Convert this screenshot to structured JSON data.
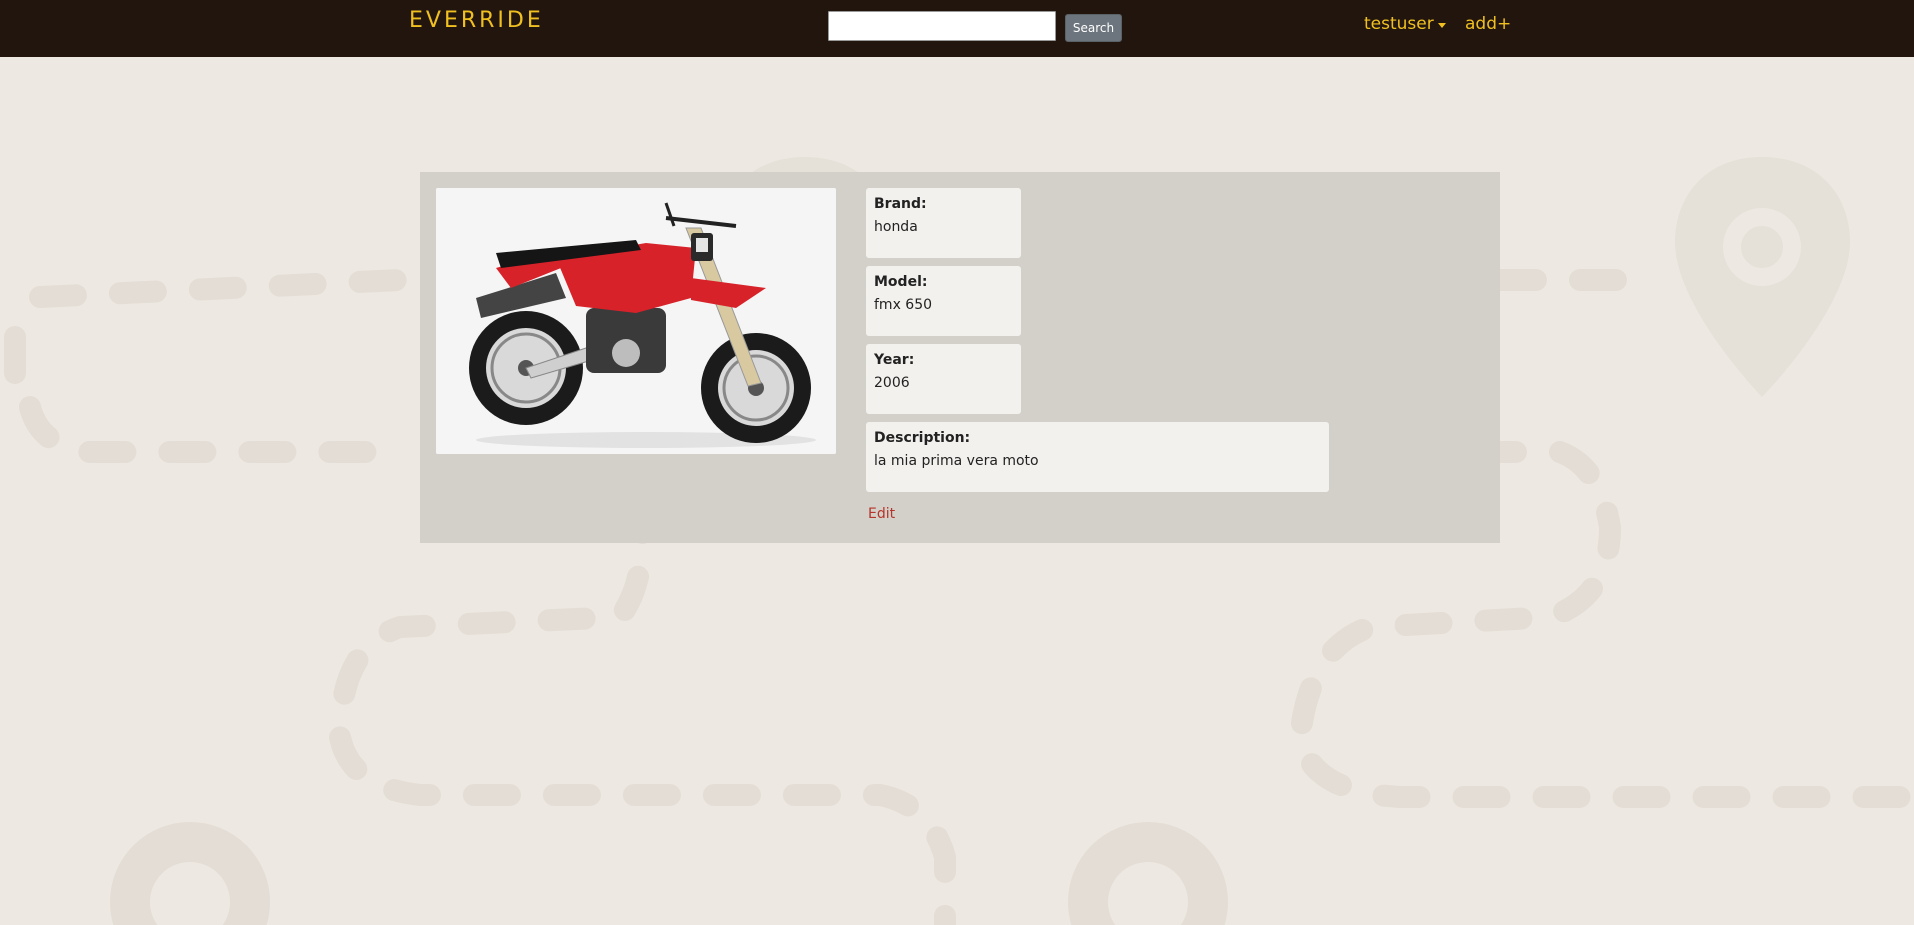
{
  "navbar": {
    "brand": "EVERRIDE",
    "search": {
      "value": "",
      "placeholder": "",
      "button_label": "Search"
    },
    "user_menu": "testuser",
    "add_link": "add+"
  },
  "motorcycle": {
    "photo_alt": "honda fmx 650",
    "fields": [
      {
        "label": "Brand:",
        "value": "honda"
      },
      {
        "label": "Model:",
        "value": "fmx 650"
      },
      {
        "label": "Year:",
        "value": "2006"
      },
      {
        "label": "Description:",
        "value": "la mia prima vera moto"
      }
    ],
    "edit_label": "Edit"
  },
  "colors": {
    "navbar_bg": "#22150e",
    "accent": "#f0c020",
    "page_bg": "#ede8e1",
    "card_bg": "#d3d0c9",
    "field_bg": "#f3f1ee",
    "edit_link": "#b5342b",
    "bike_red": "#d8222a"
  },
  "icons": [
    "map-pin-icon",
    "dashed-route-pattern",
    "caret-down-icon"
  ]
}
